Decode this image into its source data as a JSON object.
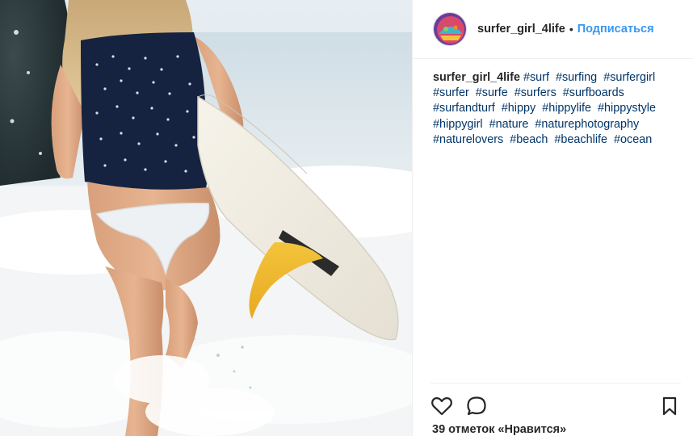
{
  "post": {
    "author": {
      "username": "surfer_girl_4life",
      "separator": "•",
      "follow_label": "Подписаться"
    },
    "caption": {
      "username": "surfer_girl_4life",
      "hashtags": [
        "#surf",
        "#surfing",
        "#surfergirl",
        "#surfer",
        "#surfe",
        "#surfers",
        "#surfboards",
        "#surfandturf",
        "#hippy",
        "#hippylife",
        "#hippystyle",
        "#hippygirl",
        "#nature",
        "#naturephotography",
        "#naturelovers",
        "#beach",
        "#beachlife",
        "#ocean"
      ]
    },
    "actions": {
      "like_icon": "heart-outline-icon",
      "comment_icon": "speech-bubble-icon",
      "save_icon": "bookmark-icon"
    },
    "likes_text": "39 отметок «Нравится»"
  },
  "colors": {
    "link_blue": "#3897f0",
    "hashtag_navy": "#003569",
    "text": "#262626",
    "divider": "#efefef"
  }
}
